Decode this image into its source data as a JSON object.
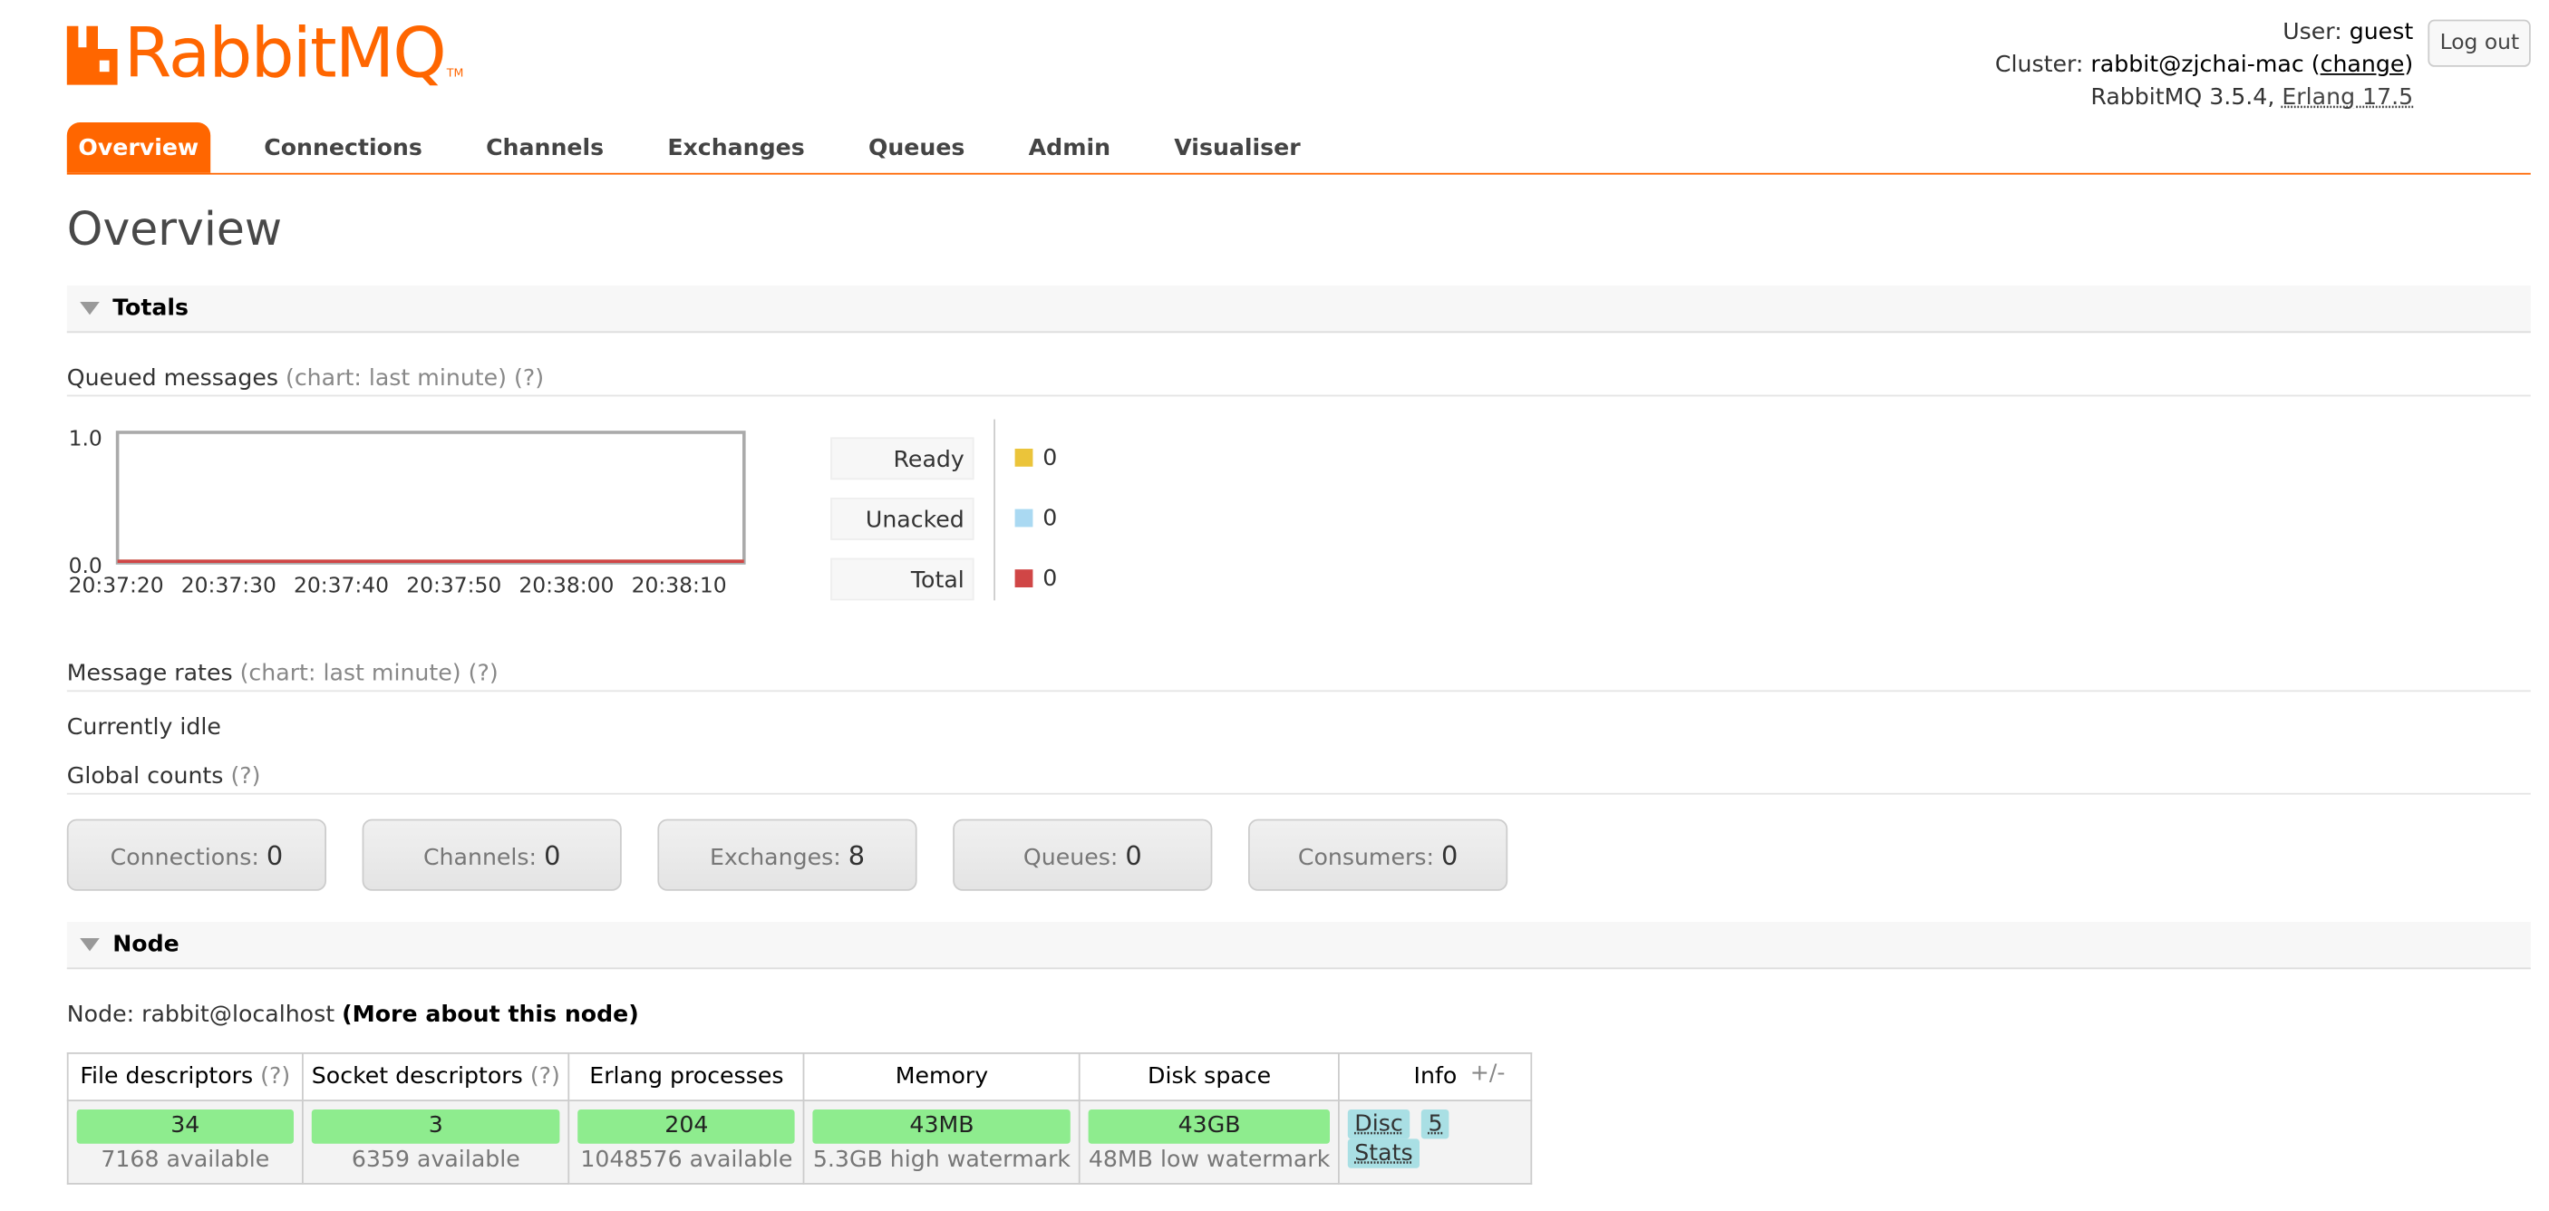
{
  "header": {
    "logo_text": "RabbitMQ",
    "logo_tm": "TM",
    "user_label": "User:",
    "user_value": "guest",
    "cluster_label": "Cluster:",
    "cluster_value": "rabbit@zjchai-mac",
    "cluster_change": "change",
    "version_text": "RabbitMQ 3.5.4,",
    "erlang_text": "Erlang 17.5",
    "logout_label": "Log out"
  },
  "tabs": [
    {
      "label": "Overview",
      "active": true
    },
    {
      "label": "Connections"
    },
    {
      "label": "Channels"
    },
    {
      "label": "Exchanges"
    },
    {
      "label": "Queues"
    },
    {
      "label": "Admin"
    },
    {
      "label": "Visualiser"
    }
  ],
  "page_title": "Overview",
  "totals": {
    "heading": "Totals",
    "queued": {
      "label": "Queued messages",
      "hint": "(chart: last minute) (?)"
    },
    "legend": [
      {
        "label": "Ready",
        "value": "0",
        "color": "#ebc43a"
      },
      {
        "label": "Unacked",
        "value": "0",
        "color": "#aad9f2"
      },
      {
        "label": "Total",
        "value": "0",
        "color": "#d04646"
      }
    ],
    "rates": {
      "label": "Message rates",
      "hint": "(chart: last minute) (?)"
    },
    "idle_text": "Currently idle",
    "global_counts": {
      "label": "Global counts",
      "hint": "(?)"
    },
    "counts": [
      {
        "label": "Connections:",
        "value": "0"
      },
      {
        "label": "Channels:",
        "value": "0"
      },
      {
        "label": "Exchanges:",
        "value": "8"
      },
      {
        "label": "Queues:",
        "value": "0"
      },
      {
        "label": "Consumers:",
        "value": "0"
      }
    ]
  },
  "chart_data": {
    "type": "line",
    "title": "",
    "x": [
      "20:37:20",
      "20:37:30",
      "20:37:40",
      "20:37:50",
      "20:38:00",
      "20:38:10"
    ],
    "ylim": [
      0.0,
      1.0
    ],
    "yticks": [
      "1.0",
      "0.0"
    ],
    "series": [
      {
        "name": "Ready",
        "values": [
          0,
          0,
          0,
          0,
          0,
          0
        ]
      },
      {
        "name": "Unacked",
        "values": [
          0,
          0,
          0,
          0,
          0,
          0
        ]
      },
      {
        "name": "Total",
        "values": [
          0,
          0,
          0,
          0,
          0,
          0
        ]
      }
    ],
    "colors": [
      "#ebc43a",
      "#aad9f2",
      "#d04646"
    ]
  },
  "node_section": {
    "heading": "Node",
    "node_label": "Node:",
    "node_name": "rabbit@localhost",
    "more_link": "(More about this node)",
    "columns": [
      {
        "label": "File descriptors",
        "hint": "(?)",
        "value": "34",
        "sub": "7168 available"
      },
      {
        "label": "Socket descriptors",
        "hint": "(?)",
        "value": "3",
        "sub": "6359 available"
      },
      {
        "label": "Erlang processes",
        "hint": "",
        "value": "204",
        "sub": "1048576 available"
      },
      {
        "label": "Memory",
        "hint": "",
        "value": "43MB",
        "sub": "5.3GB high watermark"
      },
      {
        "label": "Disk space",
        "hint": "",
        "value": "43GB",
        "sub": "48MB low watermark"
      }
    ],
    "info_label": "Info",
    "info_badges": [
      "Disc",
      "5",
      "Stats"
    ],
    "plus_minus": "+/-"
  }
}
